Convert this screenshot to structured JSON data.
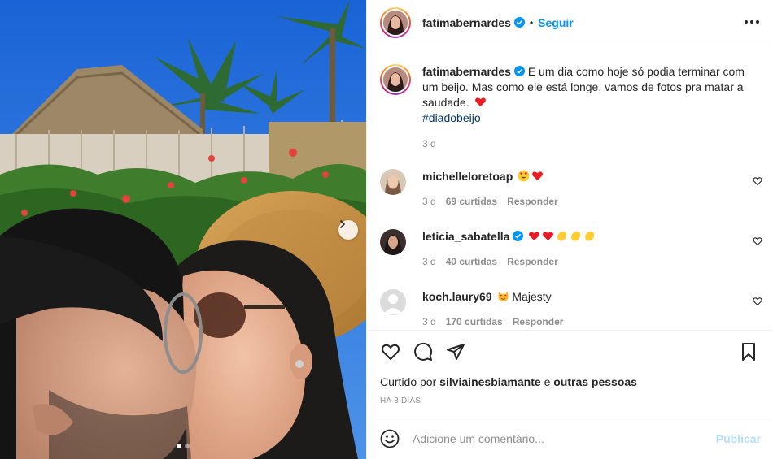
{
  "post": {
    "author": "fatimabernardes",
    "follow_label": "Seguir",
    "separator": "•",
    "more_icon": "more-horizontal-icon",
    "carousel": {
      "slide": 1,
      "total": 2
    }
  },
  "caption": {
    "author": "fatimabernardes",
    "text": "E um dia como hoje só podia terminar com um beijo. Mas como ele está longe, vamos de fotos pra matar a saudade.",
    "emoji": "red-heart-emoji",
    "hashtag": "#diadobeijo",
    "time": "3 d"
  },
  "comments": [
    {
      "user": "michelleloretoap",
      "verified": false,
      "text": "",
      "emojis": [
        "heart-eyes-emoji",
        "red-heart-emoji"
      ],
      "time": "3 d",
      "likes": "69 curtidas",
      "reply": "Responder"
    },
    {
      "user": "leticia_sabatella",
      "verified": true,
      "text": "",
      "emojis": [
        "red-heart-emoji",
        "red-heart-emoji",
        "clap-emoji",
        "clap-emoji",
        "clap-emoji"
      ],
      "time": "3 d",
      "likes": "40 curtidas",
      "reply": "Responder"
    },
    {
      "user": "koch.laury69",
      "verified": false,
      "text": "Majesty",
      "emojis": [
        "heart-eyes-cat-emoji"
      ],
      "time": "3 d",
      "likes": "170 curtidas",
      "reply": "Responder"
    }
  ],
  "actions": {
    "liked_by_prefix": "Curtido por",
    "liked_by_user": "silviainesbiamante",
    "liked_by_suffix": "e",
    "liked_by_others": "outras pessoas",
    "posted_ago": "HÁ 3 DIAS"
  },
  "add_comment": {
    "placeholder": "Adicione um comentário...",
    "publish_label": "Publicar"
  },
  "colors": {
    "accent": "#0095f6",
    "publish_disabled": "#b2dffc",
    "muted": "#8e8e8e",
    "hashtag": "#00376b",
    "heart": "#ed1c24"
  }
}
